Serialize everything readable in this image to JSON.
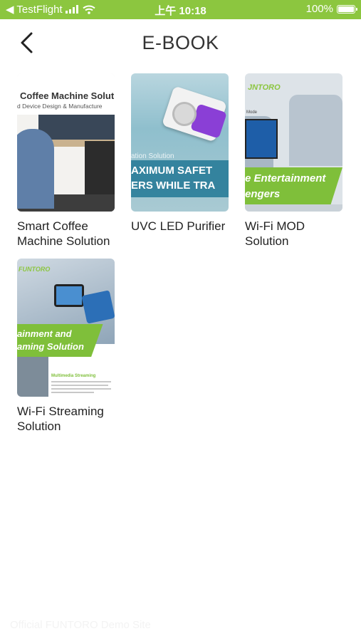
{
  "status_bar": {
    "back_app": "◀ TestFlight",
    "time": "上午 10:18",
    "battery_text": "100%",
    "battery_level": 1.0
  },
  "header": {
    "title": "E-BOOK",
    "back_icon": "chevron-left-icon"
  },
  "books": [
    {
      "title": "Smart Coffee Machine Solution",
      "cover": {
        "line1": "Coffee Machine Solut",
        "line2": "d Device Design & Manufacture"
      }
    },
    {
      "title": "UVC LED Purifier",
      "cover": {
        "small": "ation Solution",
        "line1": "AXIMUM SAFET",
        "line2": "ERS WHILE TRA"
      }
    },
    {
      "title": "Wi-Fi MOD Solution",
      "cover": {
        "brand": "JNTORO",
        "sub": "Mode",
        "line1": "e Entertainment",
        "line2": "engers"
      }
    },
    {
      "title": "Wi-Fi Streaming Solution",
      "cover": {
        "brand": "FUNTORO",
        "line1": "ainment and",
        "line2": "aming Solution",
        "section": "Multimedia Streaming"
      }
    }
  ],
  "footer": {
    "note": "Official FUNTORO Demo Site"
  },
  "colors": {
    "status_bar": "#8cc63f",
    "brand_green": "#7fbf3a"
  }
}
